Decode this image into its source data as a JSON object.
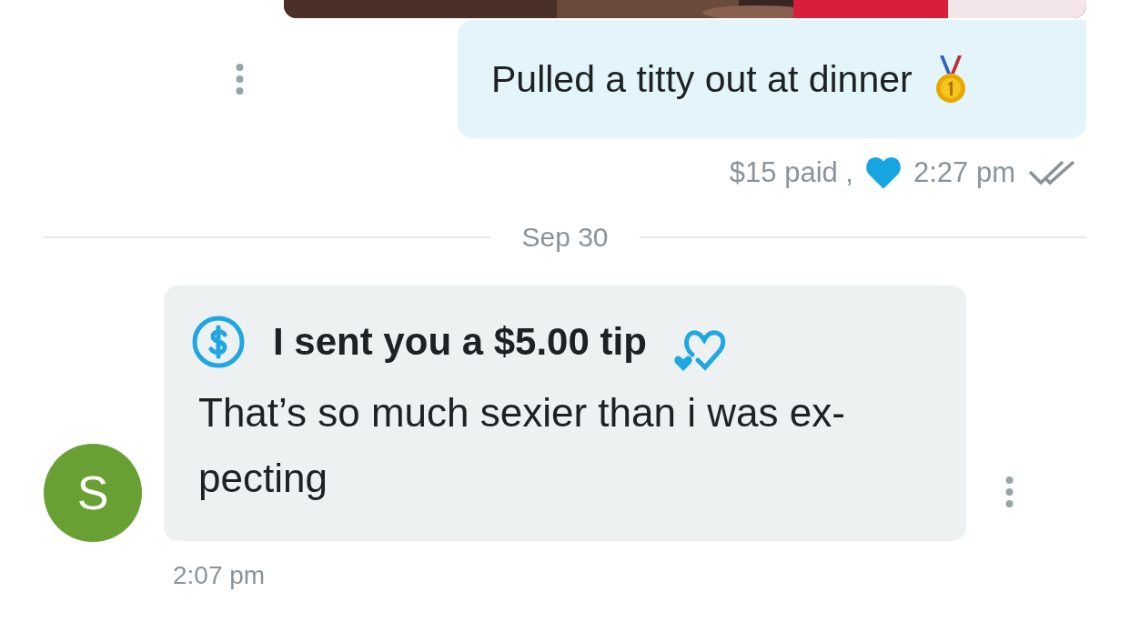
{
  "outgoing": {
    "text": "Pulled a titty out at dinner",
    "price": "$15 paid ,",
    "liked": true,
    "time": "2:27 pm",
    "read": true
  },
  "date_divider": "Sep 30",
  "incoming": {
    "avatar": "S",
    "tip": "I sent you a $5.00 tip",
    "lines": [
      "That’s so much sexier than i was ex-",
      "pecting"
    ],
    "time": "2:07 pm"
  }
}
